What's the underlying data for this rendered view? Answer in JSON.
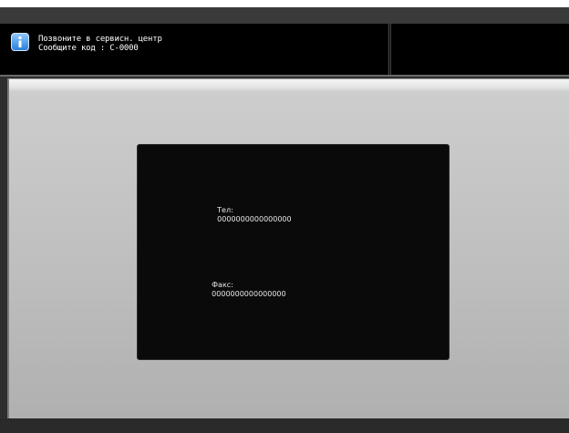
{
  "message": {
    "line1": "Позвоните в сервисн. центр",
    "line2": "Сообщите код : C-0000",
    "icon": "info-icon"
  },
  "contact": {
    "tel_label": "Тел:",
    "tel_value": "0000000000000000",
    "fax_label": "Факс:",
    "fax_value": "0000000000000000"
  },
  "colors": {
    "info_icon": "#2a7fd8",
    "panel_bg": "#000000",
    "main_bg": "#c4c4c4"
  }
}
